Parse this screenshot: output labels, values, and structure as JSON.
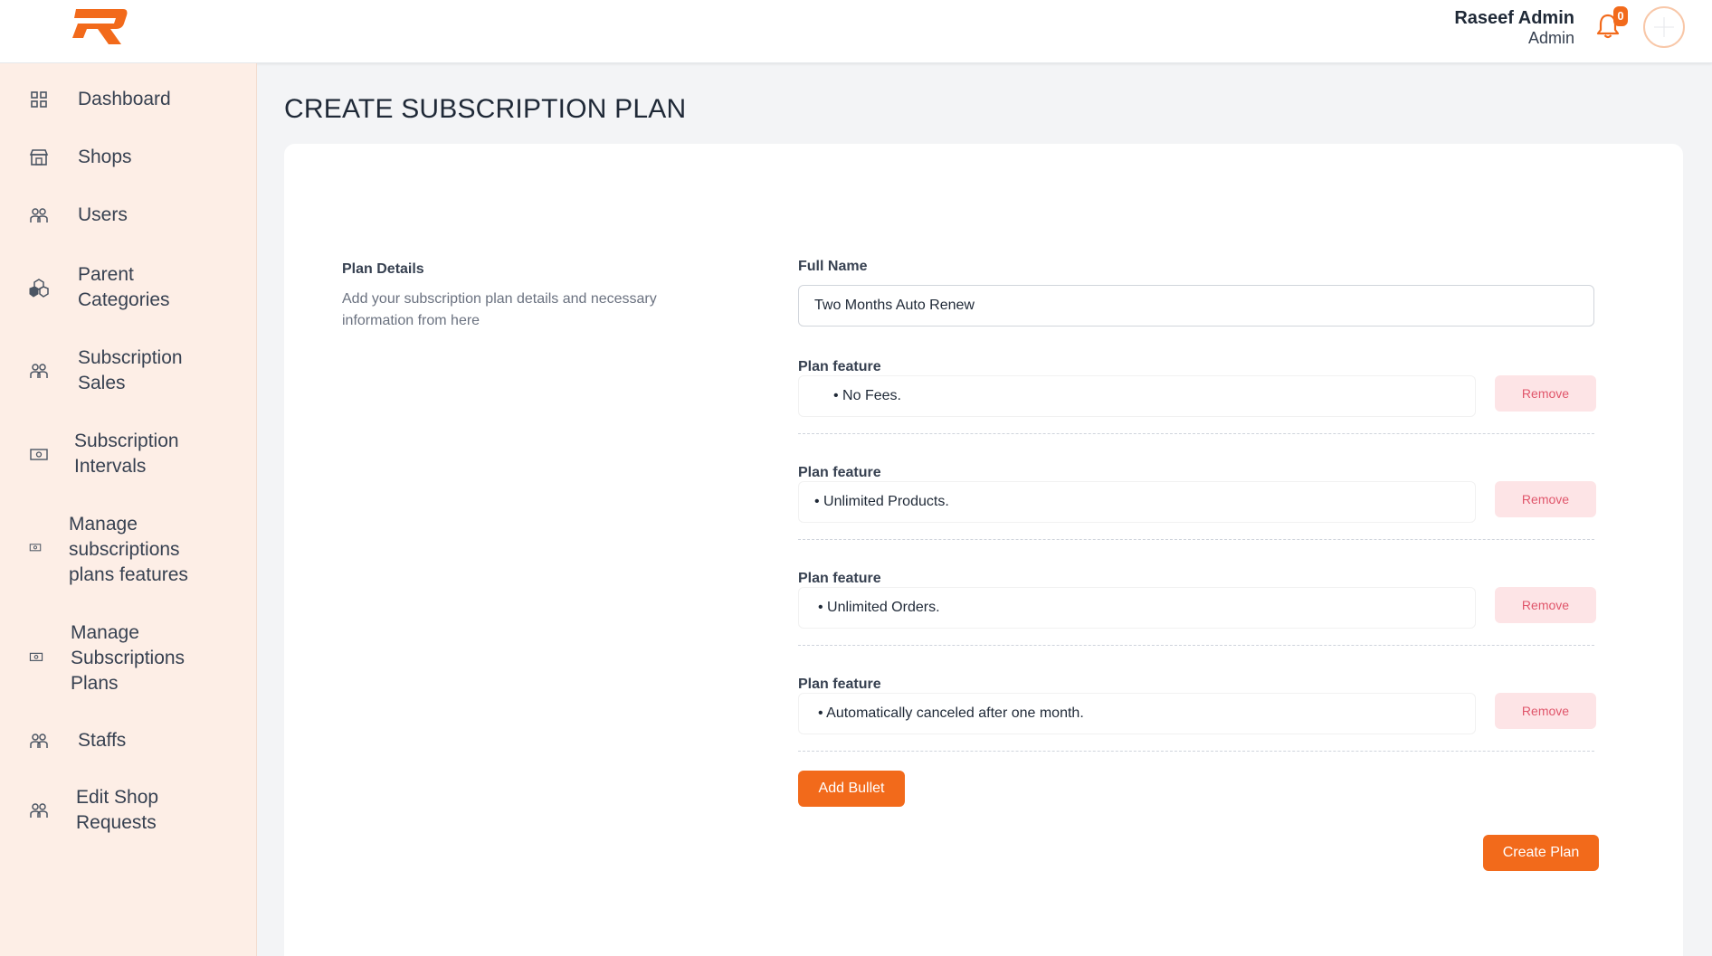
{
  "header": {
    "user_name": "Raseef Admin",
    "user_role": "Admin",
    "notification_count": "0",
    "brand_color": "#f26a1b"
  },
  "sidebar": {
    "items": [
      {
        "label": "Dashboard",
        "icon": "grid-icon"
      },
      {
        "label": "Shops",
        "icon": "store-icon"
      },
      {
        "label": "Users",
        "icon": "users-icon"
      },
      {
        "label": "Parent Categories",
        "icon": "cubes-icon"
      },
      {
        "label": "Subscription Sales",
        "icon": "users-icon"
      },
      {
        "label": "Subscription Intervals",
        "icon": "money-icon"
      },
      {
        "label": "Manage subscriptions plans features",
        "icon": "money-icon"
      },
      {
        "label": "Manage Subscriptions Plans",
        "icon": "money-icon"
      },
      {
        "label": "Staffs",
        "icon": "users-icon"
      },
      {
        "label": "Edit Shop Requests",
        "icon": "users-icon"
      }
    ]
  },
  "main": {
    "page_title": "CREATE SUBSCRIPTION PLAN",
    "section_title": "Plan Details",
    "section_description": "Add your subscription plan details and necessary information from here",
    "full_name_label": "Full Name",
    "full_name_value": "Two Months Auto Renew",
    "feature_label": "Plan feature",
    "remove_label": "Remove",
    "features": [
      "• No Fees.",
      "• Unlimited Products.",
      "• Unlimited Orders.",
      "• Automatically canceled after one month."
    ],
    "add_bullet_label": "Add Bullet",
    "create_plan_label": "Create Plan"
  }
}
